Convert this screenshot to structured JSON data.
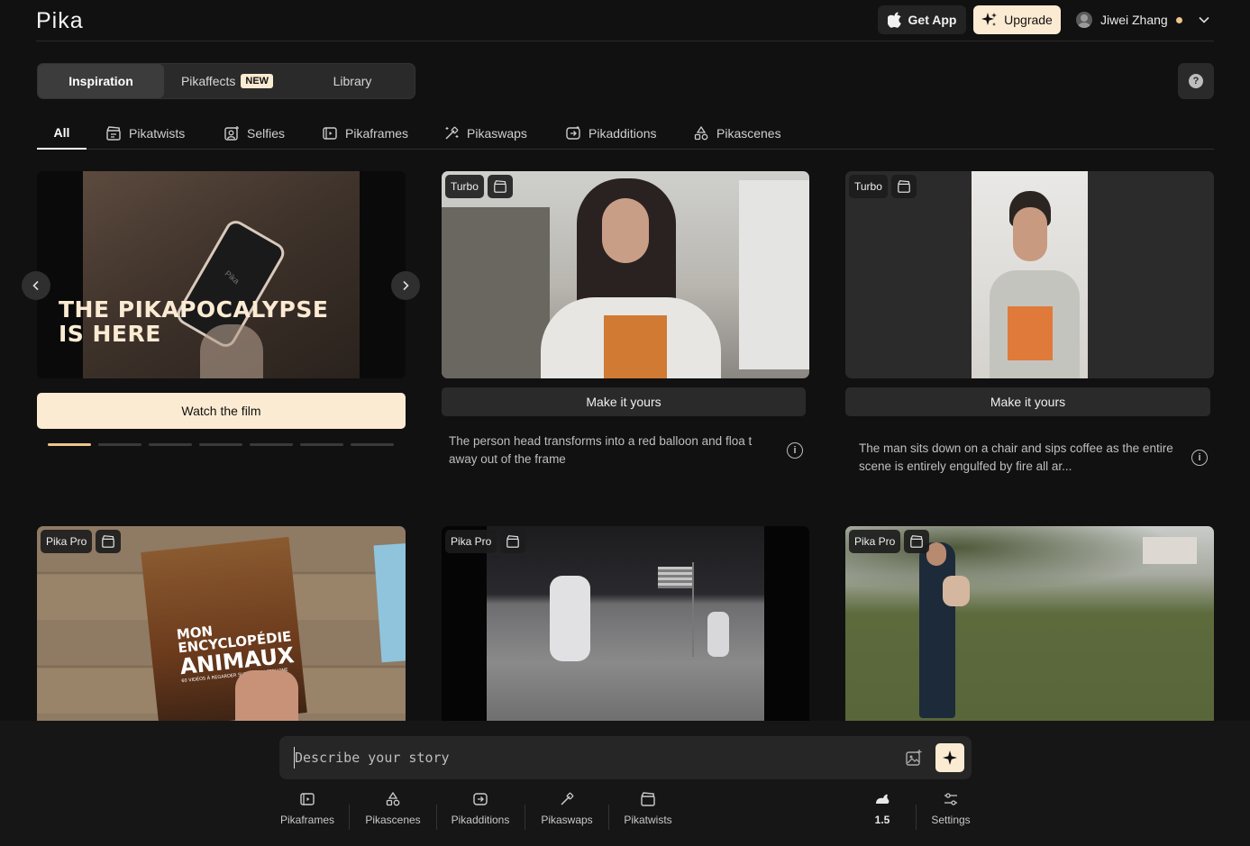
{
  "header": {
    "logo": "Pika",
    "get_app": "Get App",
    "upgrade": "Upgrade",
    "user_name": "Jiwei Zhang",
    "icons": [
      "apple-icon",
      "sparkle-icon",
      "avatar",
      "chevron-down-icon"
    ]
  },
  "main_tabs": {
    "inspiration": "Inspiration",
    "pikaffects": "Pikaffects",
    "pikaffects_badge": "NEW",
    "library": "Library",
    "help": "?"
  },
  "categories": [
    "All",
    "Pikatwists",
    "Selfies",
    "Pikaframes",
    "Pikaswaps",
    "Pikadditions",
    "Pikascenes"
  ],
  "feature_card": {
    "headline_line1": "THE PIKAPOCALYPSE",
    "headline_line2": "IS HERE",
    "watch_label": "Watch the film",
    "slides_total": 7,
    "active_slide": 1,
    "prev": "‹",
    "next": "›"
  },
  "cards": [
    {
      "badge": "Turbo",
      "button": "Make it yours",
      "description": "The person head transforms into a red balloon and floa t away out of the frame"
    },
    {
      "badge": "Turbo",
      "button": "Make it yours",
      "description": "The man sits down on a chair and sips coffee as the entire scene is entirely engulfed by fire all ar..."
    },
    {
      "badge": "Pika Pro",
      "book_line1": "MON",
      "book_line2": "ENCYCLOPÉDIE",
      "book_line3": "ANIMAUX",
      "book_line4": "60 VIDÉOS À REGARDER SUR UN SMARTPHONE"
    },
    {
      "badge": "Pika Pro"
    },
    {
      "badge": "Pika Pro"
    }
  ],
  "prompt": {
    "placeholder": "Describe your story"
  },
  "toolbar": {
    "items": [
      "Pikaframes",
      "Pikascenes",
      "Pikadditions",
      "Pikaswaps",
      "Pikatwists"
    ],
    "model": "1.5",
    "settings": "Settings"
  },
  "colors": {
    "accent": "#fcebd3",
    "background": "#111111",
    "surface": "#2a2a2a",
    "status_dot": "#f1c48a"
  }
}
